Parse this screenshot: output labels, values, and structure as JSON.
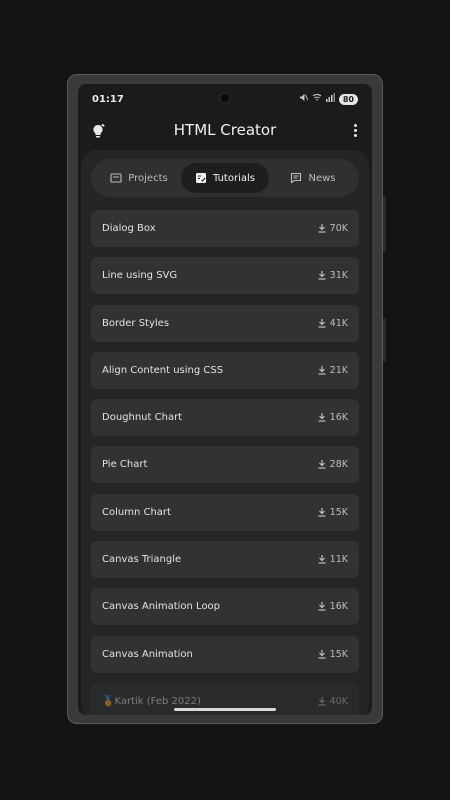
{
  "status": {
    "time": "01:17",
    "battery": "80"
  },
  "app": {
    "title": "HTML Creator"
  },
  "tabs": [
    {
      "label": "Projects",
      "icon": "window-icon"
    },
    {
      "label": "Tutorials",
      "icon": "document-icon",
      "active": true
    },
    {
      "label": "News",
      "icon": "message-icon"
    }
  ],
  "tutorials": [
    {
      "title": "Dialog Box",
      "downloads": "70K"
    },
    {
      "title": "Line using SVG",
      "downloads": "31K"
    },
    {
      "title": "Border Styles",
      "downloads": "41K"
    },
    {
      "title": "Align Content using CSS",
      "downloads": "21K"
    },
    {
      "title": "Doughnut Chart",
      "downloads": "16K"
    },
    {
      "title": "Pie Chart",
      "downloads": "28K"
    },
    {
      "title": "Column Chart",
      "downloads": "15K"
    },
    {
      "title": "Canvas Triangle",
      "downloads": "11K"
    },
    {
      "title": "Canvas Animation Loop",
      "downloads": "16K"
    },
    {
      "title": "Canvas Animation",
      "downloads": "15K"
    },
    {
      "title": "🏅Kartik (Feb 2022)",
      "downloads": "40K"
    }
  ]
}
